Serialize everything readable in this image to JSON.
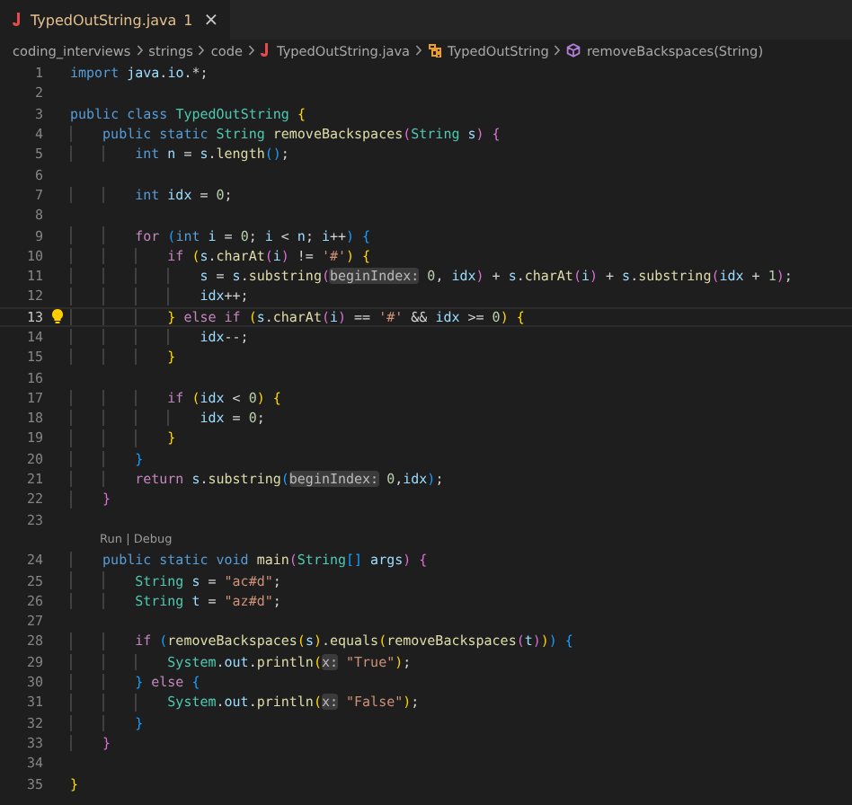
{
  "tab": {
    "label": "TypedOutString.java",
    "problems": "1",
    "close": "×",
    "selected": true
  },
  "breadcrumbs": [
    {
      "kind": "folder",
      "label": "coding_interviews"
    },
    {
      "kind": "folder",
      "label": "strings"
    },
    {
      "kind": "folder",
      "label": "code"
    },
    {
      "kind": "file",
      "label": "TypedOutString.java"
    },
    {
      "kind": "class",
      "label": "TypedOutString"
    },
    {
      "kind": "method",
      "label": "removeBackspaces(String)"
    }
  ],
  "lines": [
    {
      "number": "1",
      "tokens": [
        {
          "kind": "k",
          "text": "import "
        },
        {
          "kind": "v",
          "text": "java"
        },
        {
          "kind": "p",
          "text": "."
        },
        {
          "kind": "v",
          "text": "io"
        },
        {
          "kind": "p",
          "text": ".*;"
        }
      ]
    },
    {
      "number": "2"
    },
    {
      "number": "3",
      "tokens": [
        {
          "kind": "k",
          "text": "public class "
        },
        {
          "kind": "t",
          "text": "TypedOutString "
        },
        {
          "kind": "b1",
          "text": "{"
        }
      ]
    },
    {
      "number": "4",
      "tokens": [
        {
          "kind": "k",
          "text": "    public static "
        },
        {
          "kind": "t",
          "text": "String "
        },
        {
          "kind": "f",
          "text": "removeBackspaces"
        },
        {
          "kind": "b2",
          "text": "("
        },
        {
          "kind": "t",
          "text": "String "
        },
        {
          "kind": "v",
          "text": "s"
        },
        {
          "kind": "b2",
          "text": ")"
        },
        {
          "kind": "b2",
          "text": " {"
        }
      ]
    },
    {
      "number": "5",
      "tokens": [
        {
          "kind": "k",
          "text": "        int "
        },
        {
          "kind": "v",
          "text": "n"
        },
        {
          "kind": "p",
          "text": " = "
        },
        {
          "kind": "v",
          "text": "s"
        },
        {
          "kind": "p",
          "text": "."
        },
        {
          "kind": "f",
          "text": "length"
        },
        {
          "kind": "b3",
          "text": "()"
        },
        {
          "kind": "p",
          "text": ";"
        }
      ]
    },
    {
      "number": "6"
    },
    {
      "number": "7",
      "tokens": [
        {
          "kind": "k",
          "text": "        int "
        },
        {
          "kind": "v",
          "text": "idx"
        },
        {
          "kind": "p",
          "text": " = "
        },
        {
          "kind": "n",
          "text": "0"
        },
        {
          "kind": "p",
          "text": ";"
        }
      ]
    },
    {
      "number": "8"
    },
    {
      "number": "9",
      "tokens": [
        {
          "kind": "c",
          "text": "        for "
        },
        {
          "kind": "b3",
          "text": "("
        },
        {
          "kind": "k",
          "text": "int "
        },
        {
          "kind": "v",
          "text": "i"
        },
        {
          "kind": "p",
          "text": " = "
        },
        {
          "kind": "n",
          "text": "0"
        },
        {
          "kind": "p",
          "text": "; "
        },
        {
          "kind": "v",
          "text": "i"
        },
        {
          "kind": "p",
          "text": " < "
        },
        {
          "kind": "v",
          "text": "n"
        },
        {
          "kind": "p",
          "text": "; "
        },
        {
          "kind": "v",
          "text": "i"
        },
        {
          "kind": "p",
          "text": "++"
        },
        {
          "kind": "b3",
          "text": ")"
        },
        {
          "kind": "b3",
          "text": " {"
        }
      ]
    },
    {
      "number": "10",
      "tokens": [
        {
          "kind": "c",
          "text": "            if "
        },
        {
          "kind": "b1",
          "text": "("
        },
        {
          "kind": "v",
          "text": "s"
        },
        {
          "kind": "p",
          "text": "."
        },
        {
          "kind": "f",
          "text": "charAt"
        },
        {
          "kind": "b2",
          "text": "("
        },
        {
          "kind": "v",
          "text": "i"
        },
        {
          "kind": "b2",
          "text": ")"
        },
        {
          "kind": "p",
          "text": " != "
        },
        {
          "kind": "s",
          "text": "'#'"
        },
        {
          "kind": "b1",
          "text": ")"
        },
        {
          "kind": "b1",
          "text": " {"
        }
      ]
    },
    {
      "number": "11",
      "tokens": [
        {
          "kind": "v",
          "text": "                s"
        },
        {
          "kind": "p",
          "text": " = "
        },
        {
          "kind": "v",
          "text": "s"
        },
        {
          "kind": "p",
          "text": "."
        },
        {
          "kind": "f",
          "text": "substring"
        },
        {
          "kind": "b2",
          "text": "("
        },
        {
          "kind": "h",
          "text": "beginIndex:"
        },
        {
          "kind": "n",
          "text": " 0"
        },
        {
          "kind": "p",
          "text": ", "
        },
        {
          "kind": "v",
          "text": "idx"
        },
        {
          "kind": "b2",
          "text": ")"
        },
        {
          "kind": "p",
          "text": " + "
        },
        {
          "kind": "v",
          "text": "s"
        },
        {
          "kind": "p",
          "text": "."
        },
        {
          "kind": "f",
          "text": "charAt"
        },
        {
          "kind": "b2",
          "text": "("
        },
        {
          "kind": "v",
          "text": "i"
        },
        {
          "kind": "b2",
          "text": ")"
        },
        {
          "kind": "p",
          "text": " + "
        },
        {
          "kind": "v",
          "text": "s"
        },
        {
          "kind": "p",
          "text": "."
        },
        {
          "kind": "f",
          "text": "substring"
        },
        {
          "kind": "b2",
          "text": "("
        },
        {
          "kind": "v",
          "text": "idx"
        },
        {
          "kind": "p",
          "text": " + "
        },
        {
          "kind": "n",
          "text": "1"
        },
        {
          "kind": "b2",
          "text": ")"
        },
        {
          "kind": "p",
          "text": ";"
        }
      ]
    },
    {
      "number": "12",
      "tokens": [
        {
          "kind": "v",
          "text": "                idx"
        },
        {
          "kind": "p",
          "text": "++;"
        }
      ]
    },
    {
      "number": "13",
      "current": true,
      "lightbulb": true,
      "tokens": [
        {
          "kind": "b1",
          "text": "            }"
        },
        {
          "kind": "c",
          "text": " else if "
        },
        {
          "kind": "b1",
          "text": "("
        },
        {
          "kind": "v",
          "text": "s"
        },
        {
          "kind": "p",
          "text": "."
        },
        {
          "kind": "f",
          "text": "charAt"
        },
        {
          "kind": "b2",
          "text": "("
        },
        {
          "kind": "v",
          "text": "i"
        },
        {
          "kind": "b2",
          "text": ")"
        },
        {
          "kind": "p",
          "text": " == "
        },
        {
          "kind": "s",
          "text": "'#'"
        },
        {
          "kind": "p",
          "text": " && "
        },
        {
          "kind": "v",
          "text": "idx"
        },
        {
          "kind": "p",
          "text": " >= "
        },
        {
          "kind": "n",
          "text": "0"
        },
        {
          "kind": "b1",
          "text": ")"
        },
        {
          "kind": "b1",
          "text": " {"
        }
      ]
    },
    {
      "number": "14",
      "tokens": [
        {
          "kind": "v",
          "text": "                idx"
        },
        {
          "kind": "p",
          "text": "--;"
        }
      ]
    },
    {
      "number": "15",
      "tokens": [
        {
          "kind": "b1",
          "text": "            }"
        }
      ]
    },
    {
      "number": "16"
    },
    {
      "number": "17",
      "tokens": [
        {
          "kind": "c",
          "text": "            if "
        },
        {
          "kind": "b1",
          "text": "("
        },
        {
          "kind": "v",
          "text": "idx"
        },
        {
          "kind": "p",
          "text": " < "
        },
        {
          "kind": "n",
          "text": "0"
        },
        {
          "kind": "b1",
          "text": ")"
        },
        {
          "kind": "b1",
          "text": " {"
        }
      ]
    },
    {
      "number": "18",
      "tokens": [
        {
          "kind": "v",
          "text": "                idx"
        },
        {
          "kind": "p",
          "text": " = "
        },
        {
          "kind": "n",
          "text": "0"
        },
        {
          "kind": "p",
          "text": ";"
        }
      ]
    },
    {
      "number": "19",
      "tokens": [
        {
          "kind": "b1",
          "text": "            }"
        }
      ]
    },
    {
      "number": "20",
      "tokens": [
        {
          "kind": "b3",
          "text": "        }"
        }
      ]
    },
    {
      "number": "21",
      "tokens": [
        {
          "kind": "c",
          "text": "        return "
        },
        {
          "kind": "v",
          "text": "s"
        },
        {
          "kind": "p",
          "text": "."
        },
        {
          "kind": "f",
          "text": "substring"
        },
        {
          "kind": "b3",
          "text": "("
        },
        {
          "kind": "h",
          "text": "beginIndex:"
        },
        {
          "kind": "n",
          "text": " 0"
        },
        {
          "kind": "p",
          "text": ","
        },
        {
          "kind": "v",
          "text": "idx"
        },
        {
          "kind": "b3",
          "text": ")"
        },
        {
          "kind": "p",
          "text": ";"
        }
      ]
    },
    {
      "number": "22",
      "tokens": [
        {
          "kind": "b2",
          "text": "    }"
        }
      ]
    },
    {
      "number": "23"
    },
    {
      "kind": "codelens",
      "actions": [
        "Run",
        "Debug"
      ],
      "separator": "|"
    },
    {
      "number": "24",
      "tokens": [
        {
          "kind": "k",
          "text": "    public static void "
        },
        {
          "kind": "f",
          "text": "main"
        },
        {
          "kind": "b2",
          "text": "("
        },
        {
          "kind": "t",
          "text": "String"
        },
        {
          "kind": "b3",
          "text": "[]"
        },
        {
          "kind": "v",
          "text": " args"
        },
        {
          "kind": "b2",
          "text": ")"
        },
        {
          "kind": "b2",
          "text": " {"
        }
      ]
    },
    {
      "number": "25",
      "tokens": [
        {
          "kind": "t",
          "text": "        String "
        },
        {
          "kind": "v",
          "text": "s"
        },
        {
          "kind": "p",
          "text": " = "
        },
        {
          "kind": "s",
          "text": "\"ac#d\""
        },
        {
          "kind": "p",
          "text": ";"
        }
      ]
    },
    {
      "number": "26",
      "tokens": [
        {
          "kind": "t",
          "text": "        String "
        },
        {
          "kind": "v",
          "text": "t"
        },
        {
          "kind": "p",
          "text": " = "
        },
        {
          "kind": "s",
          "text": "\"az#d\""
        },
        {
          "kind": "p",
          "text": ";"
        }
      ]
    },
    {
      "number": "27"
    },
    {
      "number": "28",
      "tokens": [
        {
          "kind": "c",
          "text": "        if "
        },
        {
          "kind": "b3",
          "text": "("
        },
        {
          "kind": "f",
          "text": "removeBackspaces"
        },
        {
          "kind": "b1",
          "text": "("
        },
        {
          "kind": "v",
          "text": "s"
        },
        {
          "kind": "b1",
          "text": ")"
        },
        {
          "kind": "p",
          "text": "."
        },
        {
          "kind": "f",
          "text": "equals"
        },
        {
          "kind": "b1",
          "text": "("
        },
        {
          "kind": "f",
          "text": "removeBackspaces"
        },
        {
          "kind": "b2",
          "text": "("
        },
        {
          "kind": "v",
          "text": "t"
        },
        {
          "kind": "b2",
          "text": ")"
        },
        {
          "kind": "b1",
          "text": ")"
        },
        {
          "kind": "b3",
          "text": ")"
        },
        {
          "kind": "b3",
          "text": " {"
        }
      ]
    },
    {
      "number": "29",
      "tokens": [
        {
          "kind": "t",
          "text": "            System"
        },
        {
          "kind": "p",
          "text": "."
        },
        {
          "kind": "v",
          "text": "out"
        },
        {
          "kind": "p",
          "text": "."
        },
        {
          "kind": "f",
          "text": "println"
        },
        {
          "kind": "b1",
          "text": "("
        },
        {
          "kind": "h",
          "text": "x:"
        },
        {
          "kind": "s",
          "text": " \"True\""
        },
        {
          "kind": "b1",
          "text": ")"
        },
        {
          "kind": "p",
          "text": ";"
        }
      ]
    },
    {
      "number": "30",
      "tokens": [
        {
          "kind": "b3",
          "text": "        }"
        },
        {
          "kind": "c",
          "text": " else "
        },
        {
          "kind": "b3",
          "text": "{"
        }
      ]
    },
    {
      "number": "31",
      "tokens": [
        {
          "kind": "t",
          "text": "            System"
        },
        {
          "kind": "p",
          "text": "."
        },
        {
          "kind": "v",
          "text": "out"
        },
        {
          "kind": "p",
          "text": "."
        },
        {
          "kind": "f",
          "text": "println"
        },
        {
          "kind": "b1",
          "text": "("
        },
        {
          "kind": "h",
          "text": "x:"
        },
        {
          "kind": "s",
          "text": " \"False\""
        },
        {
          "kind": "b1",
          "text": ")"
        },
        {
          "kind": "p",
          "text": ";"
        }
      ]
    },
    {
      "number": "32",
      "tokens": [
        {
          "kind": "b3",
          "text": "        }"
        }
      ]
    },
    {
      "number": "33",
      "tokens": [
        {
          "kind": "b2",
          "text": "    }"
        }
      ]
    },
    {
      "number": "34"
    },
    {
      "number": "35",
      "tokens": [
        {
          "kind": "b1",
          "text": "}"
        }
      ]
    }
  ]
}
